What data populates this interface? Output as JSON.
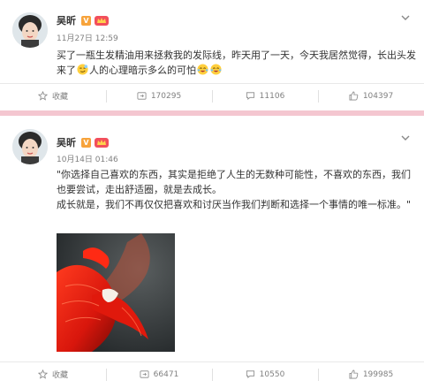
{
  "posts": [
    {
      "author": "吴昕",
      "vip_badge": "V",
      "timestamp": "11月27日 12:59",
      "text_parts": [
        "买了一瓶生发精油用来拯救我的发际线，昨天用了一天，今天我居然觉得，长出头发来了",
        "人的心理暗示多么的可怕"
      ],
      "emoji_icons": [
        "smirk-emoji-icon",
        "laugh-cry-emoji-icon"
      ],
      "actions": {
        "favorite": "收藏",
        "repost": "170295",
        "comment": "11106",
        "like": "104397"
      }
    },
    {
      "author": "吴昕",
      "vip_badge": "V",
      "timestamp": "10月14日 01:46",
      "paragraphs": [
        "\"你选择自己喜欢的东西，其实是拒绝了人生的无数种可能性，不喜欢的东西，我们也要尝试，走出舒适圈，就是去成长。",
        "成长就是，我们不再仅仅把喜欢和讨厌当作我们判断和选择一个事情的唯一标准。\""
      ],
      "image_icon": "betta-fish-photo",
      "actions": {
        "favorite": "收藏",
        "repost": "66471",
        "comment": "10550",
        "like": "199985"
      }
    }
  ],
  "colors": {
    "accent_divider": "#f4c6d0",
    "vip": "#f7a33b",
    "meta_text": "#808080"
  }
}
